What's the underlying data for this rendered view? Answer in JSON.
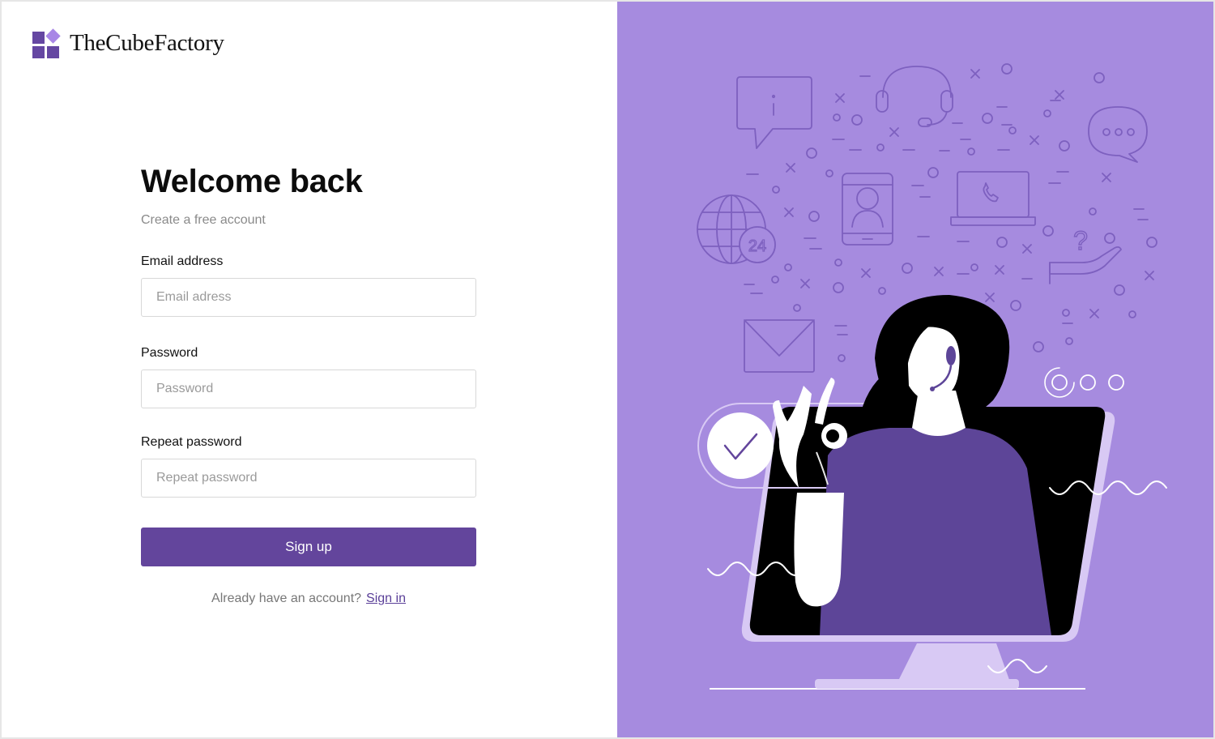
{
  "brand": {
    "name": "TheCubeFactory",
    "colors": {
      "primary": "#63459c",
      "accent": "#a886e6",
      "panel": "#a68bdf"
    }
  },
  "form": {
    "title": "Welcome back",
    "subtitle": "Create a free account",
    "email": {
      "label": "Email address",
      "placeholder": "Email adress"
    },
    "password": {
      "label": "Password",
      "placeholder": "Password"
    },
    "repeat_password": {
      "label": "Repeat password",
      "placeholder": "Repeat password"
    },
    "submit_label": "Sign up",
    "footer_text": "Already have an account?",
    "signin_link": "Sign in"
  },
  "illustration": {
    "clock_text": "24",
    "question_text": "?",
    "info_text": "i",
    "icons": [
      "chat-info-icon",
      "headset-icon",
      "chat-dots-icon",
      "globe-24-icon",
      "phone-profile-icon",
      "laptop-call-icon",
      "question-hand-icon",
      "envelope-icon",
      "check-badge-icon",
      "support-agent-figure",
      "monitor-icon"
    ]
  }
}
